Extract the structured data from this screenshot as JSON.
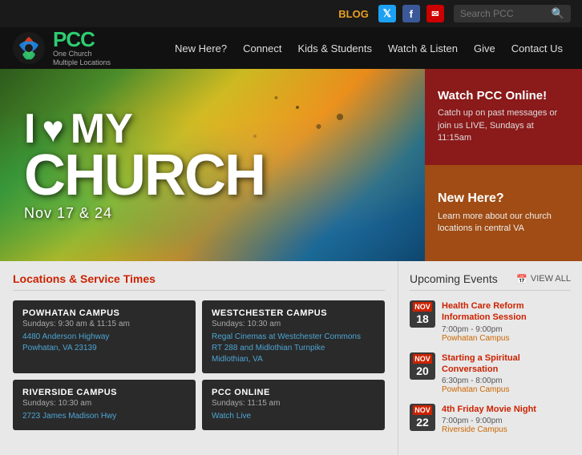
{
  "topbar": {
    "blog_label": "BLOG",
    "search_placeholder": "Search PCC"
  },
  "nav": {
    "logo_pcc": "PCC",
    "logo_sub1": "One Church",
    "logo_sub2": "Multiple Locations",
    "links": [
      {
        "label": "New Here?",
        "id": "new-here"
      },
      {
        "label": "Connect",
        "id": "connect"
      },
      {
        "label": "Kids & Students",
        "id": "kids"
      },
      {
        "label": "Watch & Listen",
        "id": "watch"
      },
      {
        "label": "Give",
        "id": "give"
      },
      {
        "label": "Contact Us",
        "id": "contact"
      }
    ]
  },
  "hero": {
    "line1": "I",
    "line2": "MY",
    "line3": "CHURCH",
    "dates": "Nov 17 & 24",
    "watch_title": "Watch PCC Online!",
    "watch_desc": "Catch up on past messages or join us LIVE, Sundays at 11:15am",
    "new_title": "New Here?",
    "new_desc": "Learn more about our church locations in central VA"
  },
  "locations": {
    "section_title": "Locations & Service Times",
    "campuses": [
      {
        "name": "POWHATAN CAMPUS",
        "times": "Sundays: 9:30 am & 11:15 am",
        "address": "4480 Anderson Highway\nPowhatan, VA 23139"
      },
      {
        "name": "WESTCHESTER CAMPUS",
        "times": "Sundays: 10:30 am",
        "address": "Regal Cinemas at Westchester Commons\nRT 288 and Midlothian Turnpike\nMidlothian, VA"
      },
      {
        "name": "RIVERSIDE CAMPUS",
        "times": "Sundays: 10:30 am",
        "address": "2723 James Madison Hwy"
      },
      {
        "name": "PCC ONLINE",
        "times": "Sundays: 11:15 am",
        "address": "Watch Live"
      }
    ]
  },
  "events": {
    "section_title": "Upcoming Events",
    "view_all_label": "VIEW ALL",
    "items": [
      {
        "month": "NOV",
        "day": "18",
        "title": "Health Care Reform Information Session",
        "time": "7:00pm - 9:00pm",
        "location": "Powhatan Campus"
      },
      {
        "month": "NOV",
        "day": "20",
        "title": "Starting a Spiritual Conversation",
        "time": "6:30pm - 8:00pm",
        "location": "Powhatan Campus"
      },
      {
        "month": "NOV",
        "day": "22",
        "title": "4th Friday Movie Night",
        "time": "7:00pm - 9:00pm",
        "location": "Riverside Campus"
      }
    ]
  }
}
